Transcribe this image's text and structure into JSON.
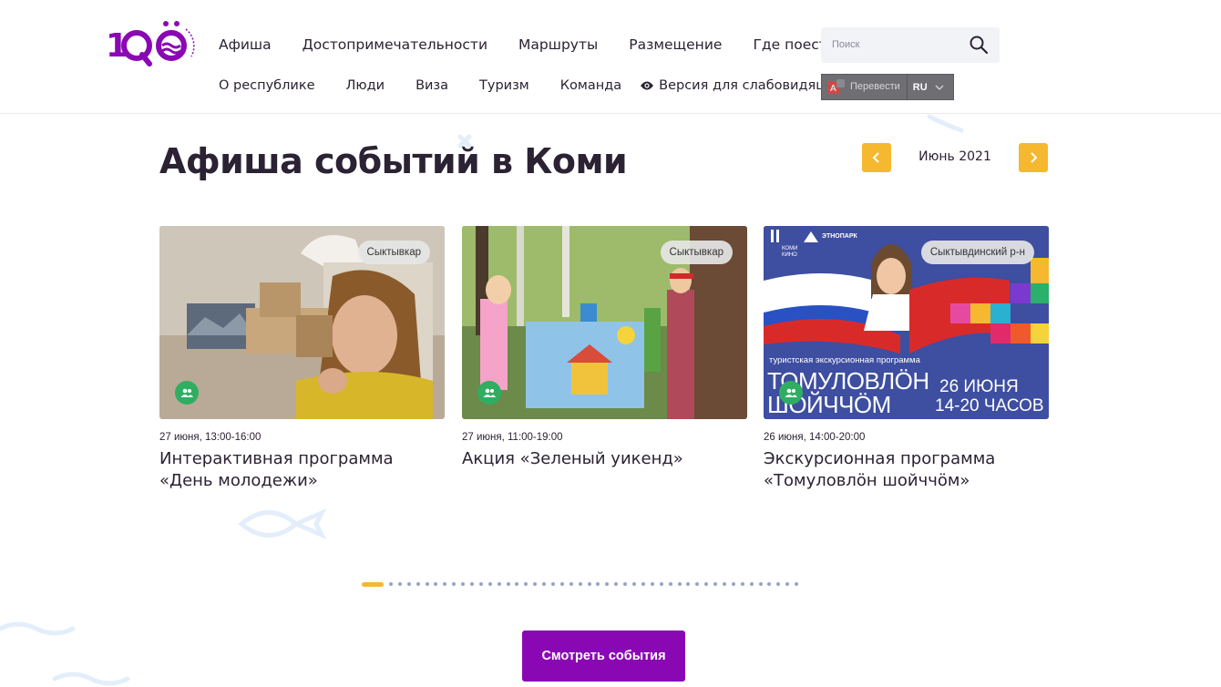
{
  "header": {
    "logo_alt": "100 лет Республике Коми",
    "nav_primary": [
      "Афиша",
      "Достопримечательности",
      "Маршруты",
      "Размещение",
      "Где поесть"
    ],
    "nav_secondary": [
      "О республике",
      "Люди",
      "Виза",
      "Туризм",
      "Команда"
    ],
    "accessibility_label": "Версия для слабовидящих",
    "search": {
      "placeholder": "Поиск",
      "icon": "search-icon"
    },
    "translate": {
      "label": "Перевести",
      "lang": "RU"
    }
  },
  "main": {
    "title": "Афиша событий в Коми",
    "month": "Июнь 2021",
    "events": [
      {
        "location": "Сыктывкар",
        "date": "27 июня, 13:00-16:00",
        "title": "Интерактивная программа «День молодежи»"
      },
      {
        "location": "Сыктывкар",
        "date": "27 июня, 11:00-19:00",
        "title": "Акция «Зеленый уикенд»"
      },
      {
        "location": "Сыктывдинский р-н",
        "date": "26 июня, 14:00-20:00",
        "title": "Экскурсионная программа «Томуловлӧн шойччӧм»",
        "poster": {
          "brand1": "КОМИ КИНО",
          "brand2": "ЭТНОПАРК",
          "subtitle": "туристская экскурсионная программа",
          "line1": "ТОМУЛОВЛӦН",
          "line2": "ШОЙЧЧӦМ",
          "date": "26 ИЮНЯ",
          "time": "14-20 ЧАСОВ"
        }
      }
    ],
    "pagination": {
      "total": 47,
      "active": 1
    },
    "cta_label": "Смотреть события"
  },
  "colors": {
    "accent": "#f5b82e",
    "brand_purple": "#8a08b4",
    "badge_green": "#2fae62",
    "text_dark": "#2b2233"
  }
}
